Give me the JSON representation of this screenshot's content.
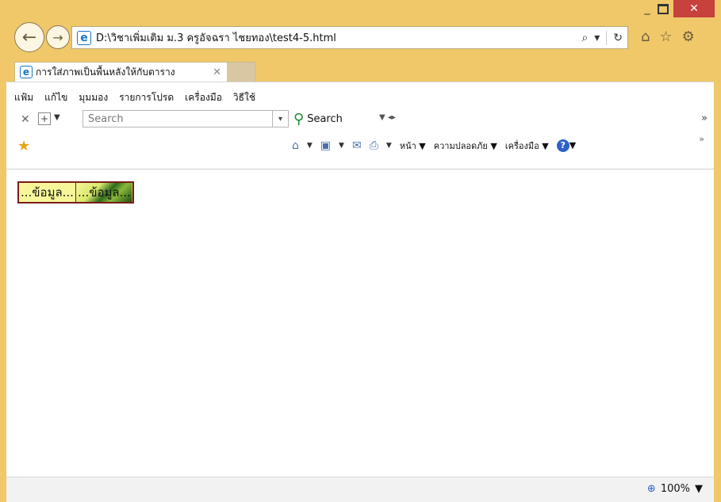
{
  "window": {
    "minimize": "_",
    "maximize": "□",
    "close": "✕"
  },
  "nav": {
    "back_icon": "←",
    "forward_icon": "→"
  },
  "address": {
    "url": "D:\\วิชาเพิ่มเติม ม.3 ครูอัจฉรา ไชยทอง\\test4-5.html",
    "search_icon": "⌕",
    "refresh_icon": "↻",
    "dropdown_icon": "▾"
  },
  "right_icons": {
    "home": "⌂",
    "star": "☆",
    "gear": "⚙"
  },
  "tab": {
    "title": "การใส่ภาพเป็นพื้นหลังให้กับตาราง",
    "close": "✕"
  },
  "menu": {
    "items": [
      "แฟ้ม",
      "แก้ไข",
      "มุมมอง",
      "รายการโปรด",
      "เครื่องมือ",
      "วิธีใช้"
    ]
  },
  "searchbar": {
    "placeholder": "Search",
    "button_label": "Search",
    "more": "»"
  },
  "commands": {
    "page": "หน้า",
    "safety": "ความปลอดภัย",
    "tools": "เครื่องมือ",
    "more": "»"
  },
  "content": {
    "cell1": "...ข้อมูล...",
    "cell2": "...ข้อมูล..."
  },
  "status": {
    "zoom": "100%"
  }
}
